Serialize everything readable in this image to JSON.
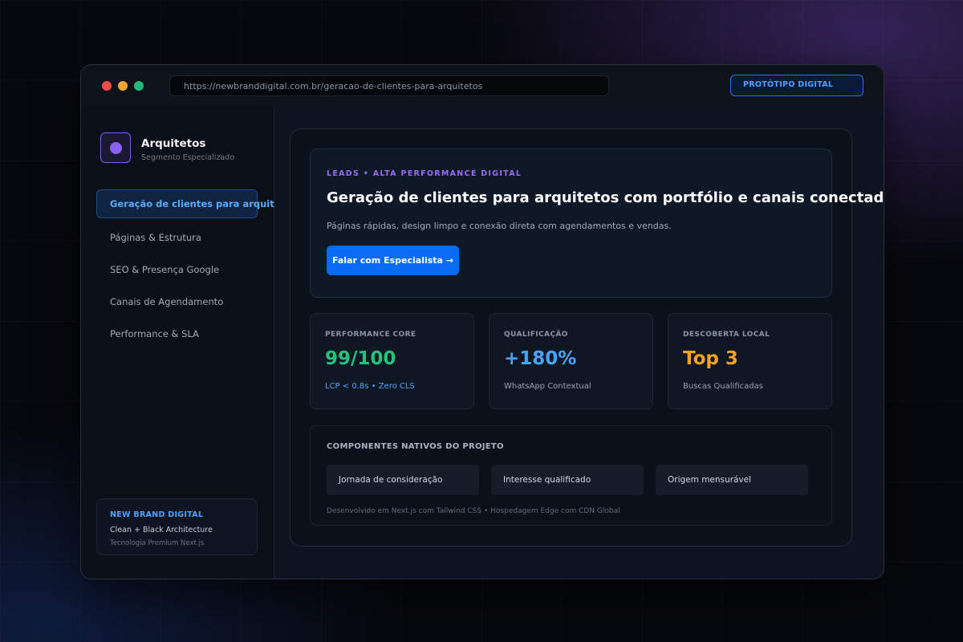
{
  "browser": {
    "url": "https://newbranddigital.com.br/geracao-de-clientes-para-arquitetos",
    "badge": "PROTÓTIPO DIGITAL"
  },
  "sidebar": {
    "brand_title": "Arquitetos",
    "brand_subtitle": "Segmento Especializado",
    "items": [
      {
        "label": "Geração de clientes para arquitetos",
        "active": true
      },
      {
        "label": "Páginas & Estrutura",
        "active": false
      },
      {
        "label": "SEO & Presença Google",
        "active": false
      },
      {
        "label": "Canais de Agendamento",
        "active": false
      },
      {
        "label": "Performance & SLA",
        "active": false
      }
    ],
    "footer": {
      "title": "NEW BRAND DIGITAL",
      "line1": "Clean + Black Architecture",
      "line2": "Tecnologia Premium Next.js"
    }
  },
  "hero": {
    "eyebrow": "LEADS • ALTA PERFORMANCE DIGITAL",
    "title": "Geração de clientes para arquitetos com portfólio e canais conectados",
    "description": "Páginas rápidas, design limpo e conexão direta com agendamentos e vendas.",
    "cta_label": "Falar com Especialista →"
  },
  "metrics": [
    {
      "label": "PERFORMANCE CORE",
      "value": "99/100",
      "sub": "LCP < 0.8s • Zero CLS",
      "value_color": "#20c27c",
      "sub_color": "#4fa3ff"
    },
    {
      "label": "QUALIFICAÇÃO",
      "value": "+180%",
      "sub": "WhatsApp Contextual",
      "value_color": "#47a4ff"
    },
    {
      "label": "DESCOBERTA LOCAL",
      "value": "Top 3",
      "sub": "Buscas Qualificadas",
      "value_color": "#f2a227"
    }
  ],
  "components": {
    "title": "COMPONENTES NATIVOS DO PROJETO",
    "chips": [
      "Jornada de consideração",
      "Interesse qualificado",
      "Origem mensurável"
    ],
    "footer": "Desenvolvido em Next.js com Tailwind CSS • Hospedagem Edge com CDN Global"
  },
  "colors": {
    "accent_blue": "#0a6cf5",
    "accent_purple": "#8b62f5"
  }
}
